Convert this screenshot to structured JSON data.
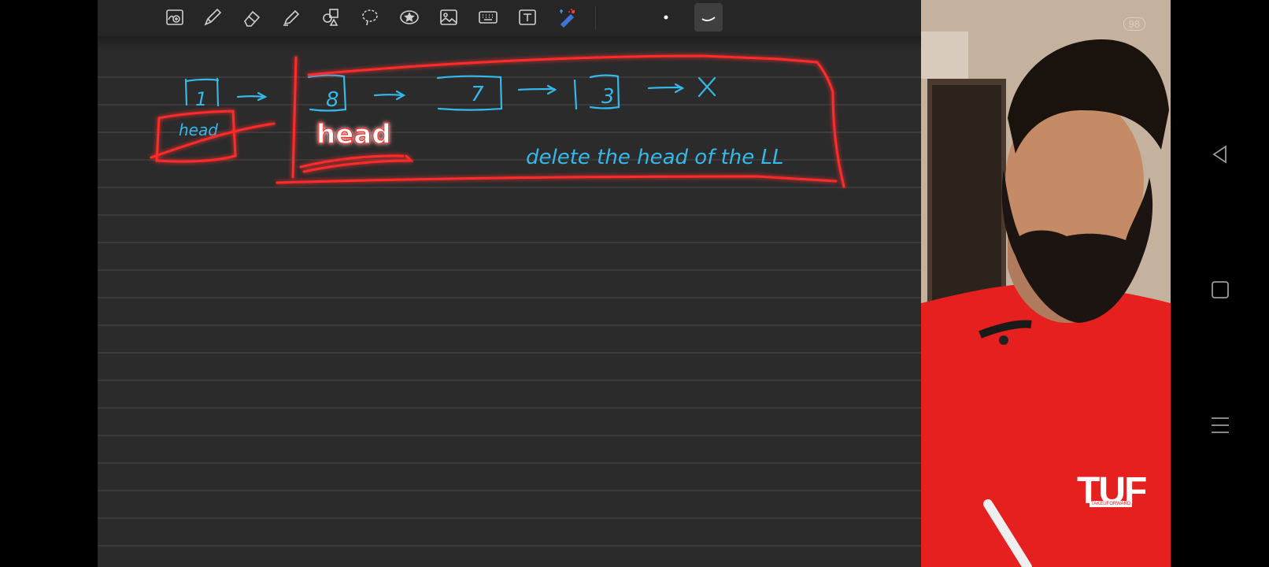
{
  "toolbar": {
    "tools": [
      {
        "name": "zoom-image-tool",
        "icon": "image-zoom-icon"
      },
      {
        "name": "pen-tool",
        "icon": "pen-icon"
      },
      {
        "name": "eraser-tool",
        "icon": "eraser-icon"
      },
      {
        "name": "highlighter-tool",
        "icon": "highlighter-icon"
      },
      {
        "name": "shapes-tool",
        "icon": "shapes-icon"
      },
      {
        "name": "lasso-tool",
        "icon": "lasso-icon"
      },
      {
        "name": "sticker-tool",
        "icon": "star-icon"
      },
      {
        "name": "image-tool",
        "icon": "image-icon"
      },
      {
        "name": "keyboard-tool",
        "icon": "keyboard-icon"
      },
      {
        "name": "text-tool",
        "icon": "text-box-icon"
      },
      {
        "name": "laser-pointer-tool",
        "icon": "laser-pointer-icon"
      }
    ],
    "pen_sizes": [
      "dot-size-icon",
      "stroke-size-icon"
    ]
  },
  "notes": {
    "ink_color": "#35b8ea",
    "highlight_color": "#ff2a2a",
    "list_nodes": [
      "1",
      "8",
      "7",
      "3"
    ],
    "terminator": "X",
    "head_label_old": "head",
    "head_label_new": "head",
    "caption": "delete the head of the LL"
  },
  "video": {
    "corner_badge": "98",
    "tshirt_logo": "TUF",
    "tshirt_subtext": "TAKEUFORWARD"
  },
  "navbar": [
    "back-icon",
    "home-icon",
    "menu-icon"
  ]
}
